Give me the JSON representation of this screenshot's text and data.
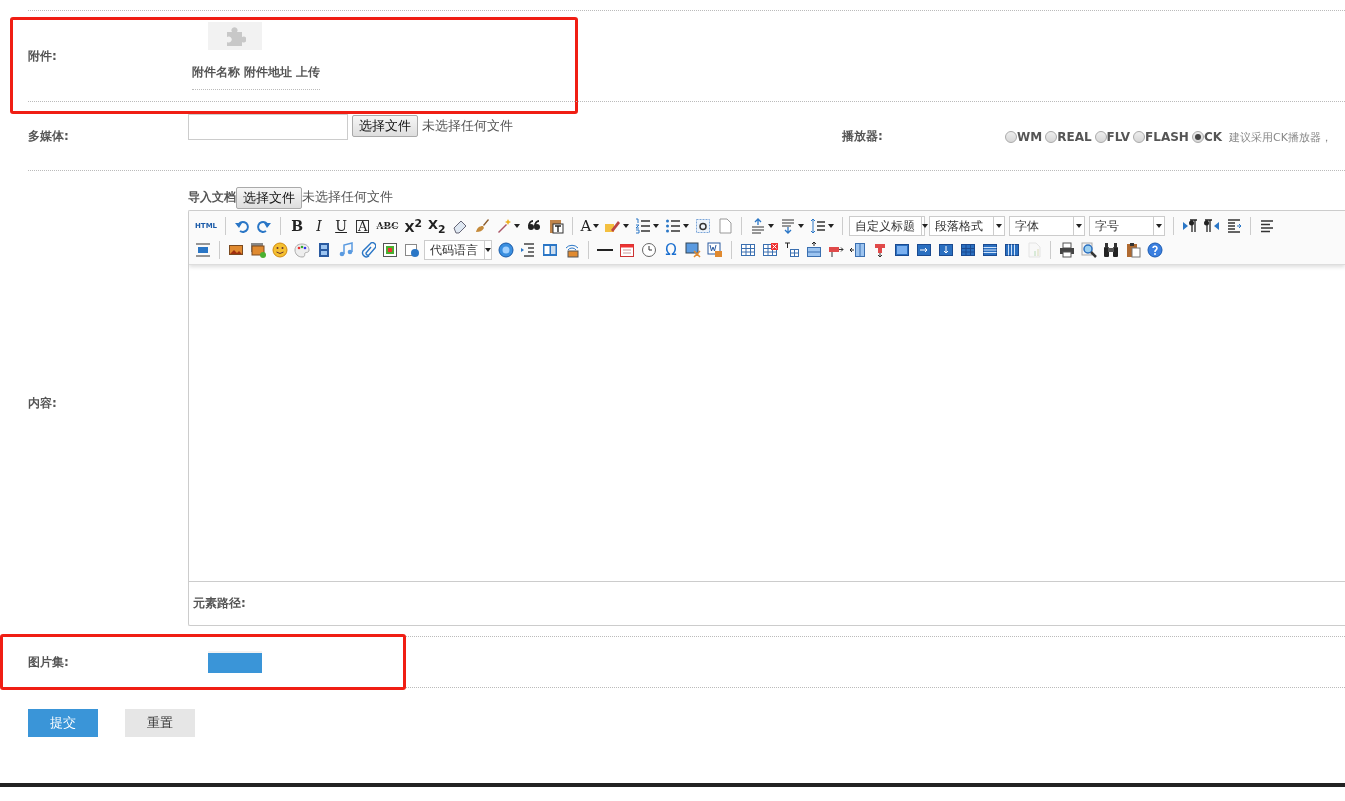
{
  "attachment": {
    "label": "附件:",
    "highlighted": true,
    "columns": [
      "附件名称",
      "附件地址",
      "上传"
    ]
  },
  "multimedia": {
    "label": "多媒体:",
    "file_button": "选择文件",
    "file_status": "未选择任何文件",
    "player_label": "播放器:",
    "players": [
      {
        "label": "WM",
        "selected": false
      },
      {
        "label": "REAL",
        "selected": false
      },
      {
        "label": "FLV",
        "selected": false
      },
      {
        "label": "FLASH",
        "selected": false
      },
      {
        "label": "CK",
        "selected": true
      }
    ],
    "player_hint": "建议采用CK播放器，"
  },
  "content": {
    "label": "内容:",
    "import_label": "导入文档",
    "file_button": "选择文件",
    "file_status": "未选择任何文件",
    "element_path_label": "元素路径:",
    "toolbar_rows": [
      [
        {
          "kind": "source",
          "text": "HTML"
        },
        {
          "kind": "separator"
        },
        {
          "kind": "button"
        },
        {
          "kind": "button"
        },
        {
          "kind": "separator"
        },
        {
          "kind": "bold",
          "text": "B"
        },
        {
          "kind": "italic",
          "text": "I"
        },
        {
          "kind": "underline",
          "text": "U"
        },
        {
          "kind": "font-border",
          "text": "A"
        },
        {
          "kind": "strikethrough",
          "text": "ABC"
        },
        {
          "kind": "superscript",
          "text": "X$^{2}$"
        },
        {
          "kind": "subscript",
          "text": "X$_{2}$"
        },
        {
          "kind": "button"
        },
        {
          "kind": "button"
        },
        {
          "kind": "button",
          "menu": true
        },
        {
          "kind": "button"
        },
        {
          "kind": "button"
        },
        {
          "kind": "separator"
        },
        {
          "kind": "font-color",
          "text": "A",
          "menu": true
        },
        {
          "kind": "button",
          "menu": true
        },
        {
          "kind": "button",
          "menu": true
        },
        {
          "kind": "button",
          "menu": true
        },
        {
          "kind": "button"
        },
        {
          "kind": "button"
        },
        {
          "kind": "separator"
        },
        {
          "kind": "button",
          "menu": true
        },
        {
          "kind": "button",
          "menu": true
        },
        {
          "kind": "button",
          "menu": true
        },
        {
          "kind": "separator"
        },
        {
          "kind": "dropdown",
          "text": "自定义标题"
        },
        {
          "kind": "dropdown",
          "text": "段落格式"
        },
        {
          "kind": "dropdown",
          "text": "字体"
        },
        {
          "kind": "dropdown",
          "text": "字号"
        },
        {
          "kind": "separator"
        },
        {
          "kind": "button"
        },
        {
          "kind": "button"
        },
        {
          "kind": "button"
        },
        {
          "kind": "separator"
        },
        {
          "kind": "button"
        }
      ],
      [
        {
          "kind": "button"
        },
        {
          "kind": "separator"
        },
        {
          "kind": "button"
        },
        {
          "kind": "button"
        },
        {
          "kind": "button"
        },
        {
          "kind": "button"
        },
        {
          "kind": "button"
        },
        {
          "kind": "button"
        },
        {
          "kind": "button"
        },
        {
          "kind": "button"
        },
        {
          "kind": "button"
        },
        {
          "kind": "dropdown",
          "text": "代码语言"
        },
        {
          "kind": "button"
        },
        {
          "kind": "button"
        },
        {
          "kind": "button"
        },
        {
          "kind": "button"
        },
        {
          "kind": "separator"
        },
        {
          "kind": "button"
        },
        {
          "kind": "button"
        },
        {
          "kind": "button"
        },
        {
          "kind": "special-character",
          "text": "Ω"
        },
        {
          "kind": "button"
        },
        {
          "kind": "button"
        },
        {
          "kind": "separator"
        },
        {
          "kind": "button"
        },
        {
          "kind": "button"
        },
        {
          "kind": "button"
        },
        {
          "kind": "button"
        },
        {
          "kind": "button"
        },
        {
          "kind": "button"
        },
        {
          "kind": "button"
        },
        {
          "kind": "button"
        },
        {
          "kind": "button"
        },
        {
          "kind": "button"
        },
        {
          "kind": "button"
        },
        {
          "kind": "button"
        },
        {
          "kind": "button"
        },
        {
          "kind": "button",
          "disabled": true
        },
        {
          "kind": "separator"
        },
        {
          "kind": "button"
        },
        {
          "kind": "button"
        },
        {
          "kind": "button"
        },
        {
          "kind": "button"
        },
        {
          "kind": "button"
        }
      ]
    ]
  },
  "gallery": {
    "label": "图片集:",
    "highlighted": true
  },
  "buttons": [
    {
      "label": "提交",
      "kind": "primary"
    },
    {
      "label": "重置",
      "kind": "secondary"
    }
  ]
}
